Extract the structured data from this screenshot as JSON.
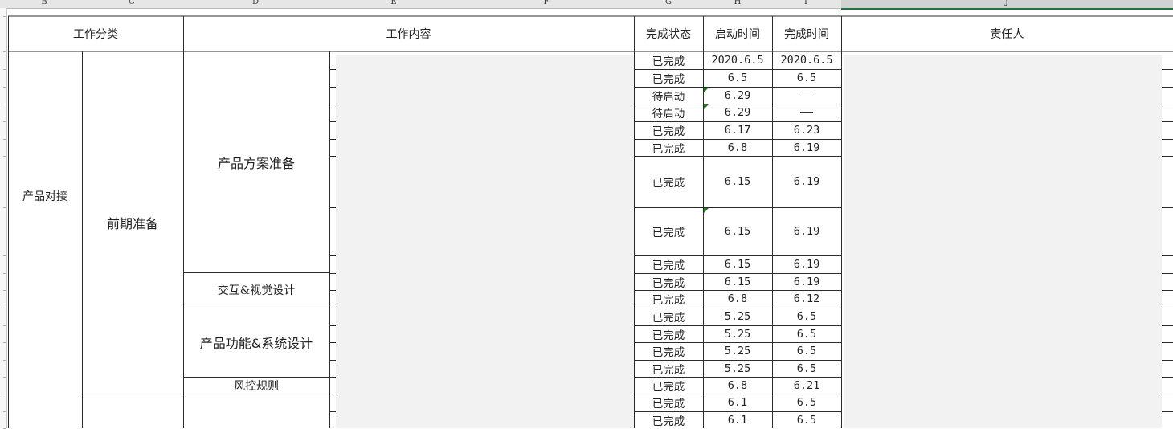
{
  "columns": [
    "B",
    "C",
    "D",
    "E",
    "F",
    "G",
    "H",
    "I",
    "J"
  ],
  "header": {
    "work_category": "工作分类",
    "work_content": "工作内容",
    "status": "完成状态",
    "start_time": "启动时间",
    "finish_time": "完成时间",
    "owner": "责任人"
  },
  "groups": {
    "level1": "产品对接",
    "level2": "前期准备",
    "sub1": "产品方案准备",
    "sub2": "交互&视觉设计",
    "sub3": "产品功能&系统设计",
    "sub4": "风控规则"
  },
  "rows": [
    {
      "status": "已完成",
      "start": "2020.6.5",
      "finish": "2020.6.5"
    },
    {
      "status": "已完成",
      "start": "6.5",
      "finish": "6.5"
    },
    {
      "status": "待启动",
      "start": "6.29",
      "finish": "——"
    },
    {
      "status": "待启动",
      "start": "6.29",
      "finish": "——"
    },
    {
      "status": "已完成",
      "start": "6.17",
      "finish": "6.23"
    },
    {
      "status": "已完成",
      "start": "6.8",
      "finish": "6.19"
    },
    {
      "status": "已完成",
      "start": "6.15",
      "finish": "6.19"
    },
    {
      "status": "已完成",
      "start": "6.15",
      "finish": "6.19"
    },
    {
      "status": "已完成",
      "start": "6.15",
      "finish": "6.19"
    },
    {
      "status": "已完成",
      "start": "6.15",
      "finish": "6.19"
    },
    {
      "status": "已完成",
      "start": "6.8",
      "finish": "6.12"
    },
    {
      "status": "已完成",
      "start": "5.25",
      "finish": "6.5"
    },
    {
      "status": "已完成",
      "start": "5.25",
      "finish": "6.5"
    },
    {
      "status": "已完成",
      "start": "5.25",
      "finish": "6.5"
    },
    {
      "status": "已完成",
      "start": "5.25",
      "finish": "6.5"
    },
    {
      "status": "已完成",
      "start": "6.8",
      "finish": "6.21"
    },
    {
      "status": "已完成",
      "start": "6.1",
      "finish": "6.5"
    },
    {
      "status": "已完成",
      "start": "6.1",
      "finish": "6.5"
    }
  ]
}
